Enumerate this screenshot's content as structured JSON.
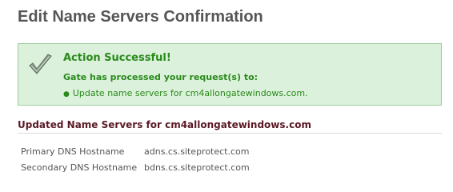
{
  "page": {
    "title": "Edit Name Servers Confirmation"
  },
  "success": {
    "icon": "checkmark-icon",
    "title": "Action Successful!",
    "subtitle": "Gate has processed your request(s) to:",
    "items": [
      "Update name servers for cm4allongatewindows.com."
    ],
    "colors": {
      "background": "#dcf1dc",
      "border": "#9ecd9e",
      "text": "#2a8a1c"
    }
  },
  "section": {
    "title": "Updated Name Servers for cm4allongatewindows.com"
  },
  "name_servers": [
    {
      "label": "Primary DNS Hostname",
      "value": "adns.cs.siteprotect.com"
    },
    {
      "label": "Secondary DNS Hostname",
      "value": "bdns.cs.siteprotect.com"
    }
  ]
}
